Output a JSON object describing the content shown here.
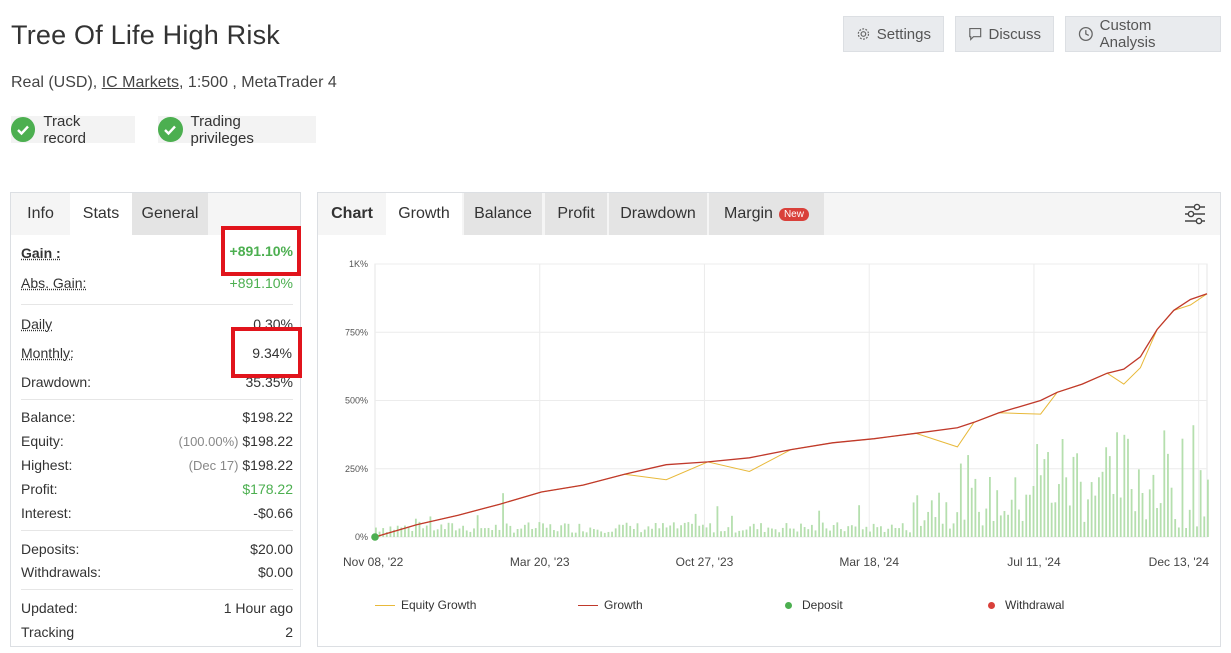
{
  "header": {
    "title": "Tree Of Life High Risk",
    "account_type": "Real (USD),",
    "broker": "IC Markets",
    "leverage_platform": ", 1:500 , MetaTrader 4"
  },
  "badges": [
    {
      "label": "Track record",
      "icon": "check-icon"
    },
    {
      "label": "Trading privileges",
      "icon": "check-icon"
    }
  ],
  "toolbar": {
    "settings": "Settings",
    "discuss": "Discuss",
    "custom_analysis": "Custom Analysis"
  },
  "left_tabs": [
    "Info",
    "Stats",
    "General"
  ],
  "stats": {
    "gain_label": "Gain :",
    "gain_value": "+891.10%",
    "abs_gain_label": "Abs. Gain:",
    "abs_gain_value": "+891.10%",
    "daily_label": "Daily",
    "daily_value": "0.30%",
    "monthly_label": "Monthly:",
    "monthly_value": "9.34%",
    "drawdown_label": "Drawdown:",
    "drawdown_value": "35.35%",
    "balance_label": "Balance:",
    "balance_value": "$198.22",
    "equity_label": "Equity:",
    "equity_pct": "(100.00%)",
    "equity_value": "$198.22",
    "highest_label": "Highest:",
    "highest_date": "(Dec 17)",
    "highest_value": "$198.22",
    "profit_label": "Profit:",
    "profit_value": "$178.22",
    "interest_label": "Interest:",
    "interest_value": "-$0.66",
    "deposits_label": "Deposits:",
    "deposits_value": "$20.00",
    "withdrawals_label": "Withdrawals:",
    "withdrawals_value": "$0.00",
    "updated_label": "Updated:",
    "updated_value": "1 Hour ago",
    "tracking_label": "Tracking",
    "tracking_value": "2"
  },
  "chart_tabs": {
    "chart": "Chart",
    "growth": "Growth",
    "balance": "Balance",
    "profit": "Profit",
    "drawdown": "Drawdown",
    "margin": "Margin",
    "new_badge": "New"
  },
  "legend": {
    "equity_growth": "Equity Growth",
    "growth": "Growth",
    "deposit": "Deposit",
    "withdrawal": "Withdrawal"
  },
  "colors": {
    "growth": "#c0392b",
    "equity": "#e8b93a",
    "bars": "#b5dfae",
    "deposit": "#4caf50",
    "withdrawal": "#d9403a",
    "highlight": "#e1141c"
  },
  "chart_data": {
    "type": "line",
    "ylabel": "",
    "yticks": [
      "0%",
      "250%",
      "500%",
      "750%",
      "1K%"
    ],
    "ylim": [
      0,
      1000
    ],
    "xticks": [
      "Nov 08, '22",
      "Mar 20, '23",
      "Oct 27, '23",
      "Mar 18, '24",
      "Jul 11, '24",
      "Dec 13, '24"
    ],
    "grid": true,
    "legend_position": "bottom",
    "series": [
      {
        "name": "Growth",
        "x": [
          0,
          0.05,
          0.1,
          0.15,
          0.2,
          0.25,
          0.3,
          0.35,
          0.4,
          0.45,
          0.5,
          0.55,
          0.6,
          0.65,
          0.7,
          0.72,
          0.75,
          0.8,
          0.82,
          0.85,
          0.88,
          0.9,
          0.92,
          0.94,
          0.96,
          0.98,
          1.0
        ],
        "values": [
          0,
          45,
          80,
          120,
          165,
          190,
          230,
          265,
          275,
          290,
          320,
          345,
          360,
          380,
          400,
          420,
          455,
          500,
          530,
          560,
          600,
          615,
          660,
          760,
          830,
          870,
          891
        ]
      },
      {
        "name": "Equity Growth",
        "x": [
          0,
          0.05,
          0.1,
          0.15,
          0.2,
          0.25,
          0.3,
          0.35,
          0.4,
          0.45,
          0.5,
          0.55,
          0.6,
          0.65,
          0.7,
          0.72,
          0.75,
          0.8,
          0.82,
          0.85,
          0.88,
          0.9,
          0.92,
          0.94,
          0.96,
          0.98,
          1.0
        ],
        "values": [
          0,
          45,
          80,
          120,
          165,
          190,
          230,
          210,
          275,
          240,
          320,
          345,
          360,
          380,
          330,
          420,
          455,
          450,
          530,
          560,
          600,
          560,
          620,
          760,
          830,
          850,
          891
        ]
      }
    ]
  }
}
